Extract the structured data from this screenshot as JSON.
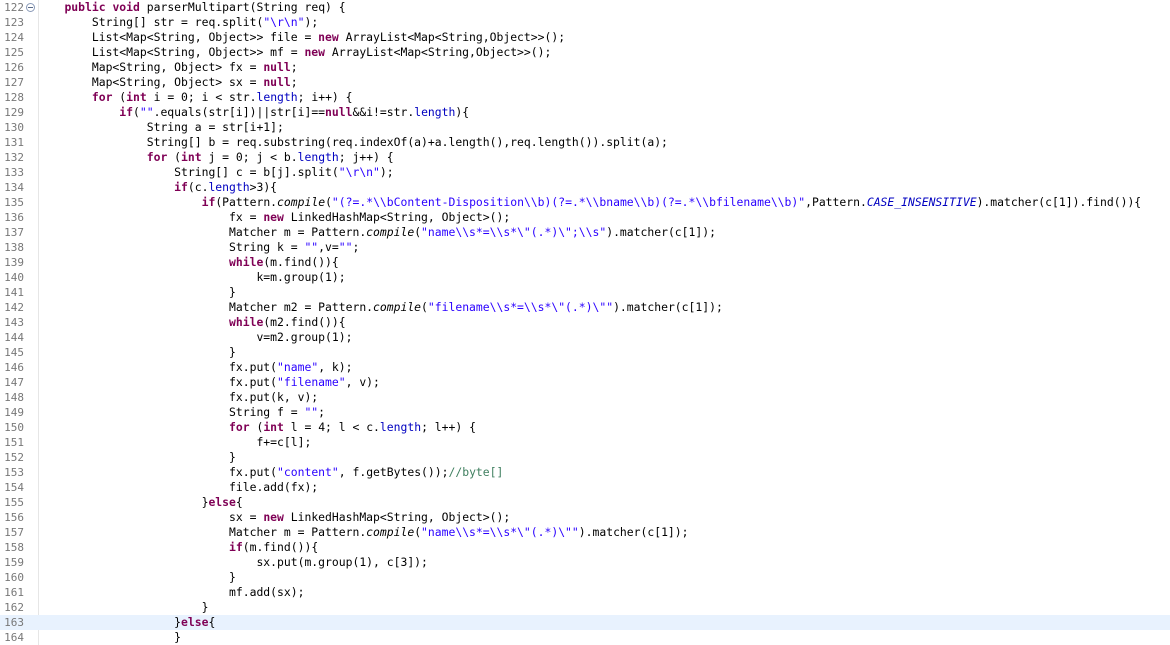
{
  "colors": {
    "keyword": "#7f0055",
    "string": "#2a00ff",
    "field": "#0000c0",
    "comment": "#3f7f5f",
    "line_number": "#787878",
    "current_line_bg": "#e8f2fe"
  },
  "editor": {
    "fold_marker_line": 0,
    "current_line": 41,
    "lines": [
      {
        "n": "122",
        "t": [
          [
            "p",
            "    "
          ],
          [
            "kw",
            "public"
          ],
          [
            "p",
            " "
          ],
          [
            "kw",
            "void"
          ],
          [
            "p",
            " parserMultipart(String req) {"
          ]
        ]
      },
      {
        "n": "123",
        "t": [
          [
            "p",
            "        String[] str = req.split("
          ],
          [
            "str",
            "\"\\r\\n\""
          ],
          [
            "p",
            ");"
          ]
        ]
      },
      {
        "n": "124",
        "t": [
          [
            "p",
            "        List<Map<String, Object>> file = "
          ],
          [
            "kw",
            "new"
          ],
          [
            "p",
            " ArrayList<Map<String,Object>>();"
          ]
        ]
      },
      {
        "n": "125",
        "t": [
          [
            "p",
            "        List<Map<String, Object>> mf = "
          ],
          [
            "kw",
            "new"
          ],
          [
            "p",
            " ArrayList<Map<String,Object>>();"
          ]
        ]
      },
      {
        "n": "126",
        "t": [
          [
            "p",
            "        Map<String, Object> fx = "
          ],
          [
            "kw",
            "null"
          ],
          [
            "p",
            ";"
          ]
        ]
      },
      {
        "n": "127",
        "t": [
          [
            "p",
            "        Map<String, Object> sx = "
          ],
          [
            "kw",
            "null"
          ],
          [
            "p",
            ";"
          ]
        ]
      },
      {
        "n": "128",
        "t": [
          [
            "p",
            "        "
          ],
          [
            "kw",
            "for"
          ],
          [
            "p",
            " ("
          ],
          [
            "kw",
            "int"
          ],
          [
            "p",
            " i = 0; i < str."
          ],
          [
            "fld",
            "length"
          ],
          [
            "p",
            "; i++) {"
          ]
        ]
      },
      {
        "n": "129",
        "t": [
          [
            "p",
            "            "
          ],
          [
            "kw",
            "if"
          ],
          [
            "p",
            "("
          ],
          [
            "str",
            "\"\""
          ],
          [
            "p",
            ".equals(str[i])||str[i]=="
          ],
          [
            "kw",
            "null"
          ],
          [
            "p",
            "&&i!=str."
          ],
          [
            "fld",
            "length"
          ],
          [
            "p",
            "){"
          ]
        ]
      },
      {
        "n": "130",
        "t": [
          [
            "p",
            "                String a = str[i+1];"
          ]
        ]
      },
      {
        "n": "131",
        "t": [
          [
            "p",
            "                String[] b = req.substring(req.indexOf(a)+a.length(),req.length()).split(a);"
          ]
        ]
      },
      {
        "n": "132",
        "t": [
          [
            "p",
            "                "
          ],
          [
            "kw",
            "for"
          ],
          [
            "p",
            " ("
          ],
          [
            "kw",
            "int"
          ],
          [
            "p",
            " j = 0; j < b."
          ],
          [
            "fld",
            "length"
          ],
          [
            "p",
            "; j++) {"
          ]
        ]
      },
      {
        "n": "133",
        "t": [
          [
            "p",
            "                    String[] c = b[j].split("
          ],
          [
            "str",
            "\"\\r\\n\""
          ],
          [
            "p",
            ");"
          ]
        ]
      },
      {
        "n": "134",
        "t": [
          [
            "p",
            "                    "
          ],
          [
            "kw",
            "if"
          ],
          [
            "p",
            "(c."
          ],
          [
            "fld",
            "length"
          ],
          [
            "p",
            ">3){"
          ]
        ]
      },
      {
        "n": "135",
        "t": [
          [
            "p",
            "                        "
          ],
          [
            "kw",
            "if"
          ],
          [
            "p",
            "(Pattern."
          ],
          [
            "mi",
            "compile"
          ],
          [
            "p",
            "("
          ],
          [
            "str",
            "\"(?=.*\\\\bContent-Disposition\\\\b)(?=.*\\\\bname\\\\b)(?=.*\\\\bfilename\\\\b)\""
          ],
          [
            "p",
            ",Pattern."
          ],
          [
            "sfi",
            "CASE_INSENSITIVE"
          ],
          [
            "p",
            ").matcher(c[1]).find()){"
          ]
        ]
      },
      {
        "n": "136",
        "t": [
          [
            "p",
            "                            fx = "
          ],
          [
            "kw",
            "new"
          ],
          [
            "p",
            " LinkedHashMap<String, Object>();"
          ]
        ]
      },
      {
        "n": "137",
        "t": [
          [
            "p",
            "                            Matcher m = Pattern."
          ],
          [
            "mi",
            "compile"
          ],
          [
            "p",
            "("
          ],
          [
            "str",
            "\"name\\\\s*=\\\\s*\\\"(.*)\\\";\\\\s\""
          ],
          [
            "p",
            ").matcher(c[1]);"
          ]
        ]
      },
      {
        "n": "138",
        "t": [
          [
            "p",
            "                            String k = "
          ],
          [
            "str",
            "\"\""
          ],
          [
            "p",
            ",v="
          ],
          [
            "str",
            "\"\""
          ],
          [
            "p",
            ";"
          ]
        ]
      },
      {
        "n": "139",
        "t": [
          [
            "p",
            "                            "
          ],
          [
            "kw",
            "while"
          ],
          [
            "p",
            "(m.find()){"
          ]
        ]
      },
      {
        "n": "140",
        "t": [
          [
            "p",
            "                                k=m.group(1);"
          ]
        ]
      },
      {
        "n": "141",
        "t": [
          [
            "p",
            "                            }"
          ]
        ]
      },
      {
        "n": "142",
        "t": [
          [
            "p",
            "                            Matcher m2 = Pattern."
          ],
          [
            "mi",
            "compile"
          ],
          [
            "p",
            "("
          ],
          [
            "str",
            "\"filename\\\\s*=\\\\s*\\\"(.*)\\\"\""
          ],
          [
            "p",
            ").matcher(c[1]);"
          ]
        ]
      },
      {
        "n": "143",
        "t": [
          [
            "p",
            "                            "
          ],
          [
            "kw",
            "while"
          ],
          [
            "p",
            "(m2.find()){"
          ]
        ]
      },
      {
        "n": "144",
        "t": [
          [
            "p",
            "                                v=m2.group(1);"
          ]
        ]
      },
      {
        "n": "145",
        "t": [
          [
            "p",
            "                            }"
          ]
        ]
      },
      {
        "n": "146",
        "t": [
          [
            "p",
            "                            fx.put("
          ],
          [
            "str",
            "\"name\""
          ],
          [
            "p",
            ", k);"
          ]
        ]
      },
      {
        "n": "147",
        "t": [
          [
            "p",
            "                            fx.put("
          ],
          [
            "str",
            "\"filename\""
          ],
          [
            "p",
            ", v);"
          ]
        ]
      },
      {
        "n": "148",
        "t": [
          [
            "p",
            "                            fx.put(k, v);"
          ]
        ]
      },
      {
        "n": "149",
        "t": [
          [
            "p",
            "                            String f = "
          ],
          [
            "str",
            "\"\""
          ],
          [
            "p",
            ";"
          ]
        ]
      },
      {
        "n": "150",
        "t": [
          [
            "p",
            "                            "
          ],
          [
            "kw",
            "for"
          ],
          [
            "p",
            " ("
          ],
          [
            "kw",
            "int"
          ],
          [
            "p",
            " l = 4; l < c."
          ],
          [
            "fld",
            "length"
          ],
          [
            "p",
            "; l++) {"
          ]
        ]
      },
      {
        "n": "151",
        "t": [
          [
            "p",
            "                                f+=c[l];"
          ]
        ]
      },
      {
        "n": "152",
        "t": [
          [
            "p",
            "                            }"
          ]
        ]
      },
      {
        "n": "153",
        "t": [
          [
            "p",
            "                            fx.put("
          ],
          [
            "str",
            "\"content\""
          ],
          [
            "p",
            ", f.getBytes());"
          ],
          [
            "cmt",
            "//byte[]"
          ]
        ]
      },
      {
        "n": "154",
        "t": [
          [
            "p",
            "                            file.add(fx);"
          ]
        ]
      },
      {
        "n": "155",
        "t": [
          [
            "p",
            "                        }"
          ],
          [
            "kw",
            "else"
          ],
          [
            "p",
            "{"
          ]
        ]
      },
      {
        "n": "156",
        "t": [
          [
            "p",
            "                            sx = "
          ],
          [
            "kw",
            "new"
          ],
          [
            "p",
            " LinkedHashMap<String, Object>();"
          ]
        ]
      },
      {
        "n": "157",
        "t": [
          [
            "p",
            "                            Matcher m = Pattern."
          ],
          [
            "mi",
            "compile"
          ],
          [
            "p",
            "("
          ],
          [
            "str",
            "\"name\\\\s*=\\\\s*\\\"(.*)\\\"\""
          ],
          [
            "p",
            ").matcher(c[1]);"
          ]
        ]
      },
      {
        "n": "158",
        "t": [
          [
            "p",
            "                            "
          ],
          [
            "kw",
            "if"
          ],
          [
            "p",
            "(m.find()){"
          ]
        ]
      },
      {
        "n": "159",
        "t": [
          [
            "p",
            "                                sx.put(m.group(1), c[3]);"
          ]
        ]
      },
      {
        "n": "160",
        "t": [
          [
            "p",
            "                            }"
          ]
        ]
      },
      {
        "n": "161",
        "t": [
          [
            "p",
            "                            mf.add(sx);"
          ]
        ]
      },
      {
        "n": "162",
        "t": [
          [
            "p",
            "                        }"
          ]
        ]
      },
      {
        "n": "163",
        "t": [
          [
            "p",
            "                    }"
          ],
          [
            "kw",
            "else"
          ],
          [
            "p",
            "{"
          ]
        ]
      },
      {
        "n": "164",
        "t": [
          [
            "p",
            "                    }"
          ]
        ]
      }
    ]
  }
}
